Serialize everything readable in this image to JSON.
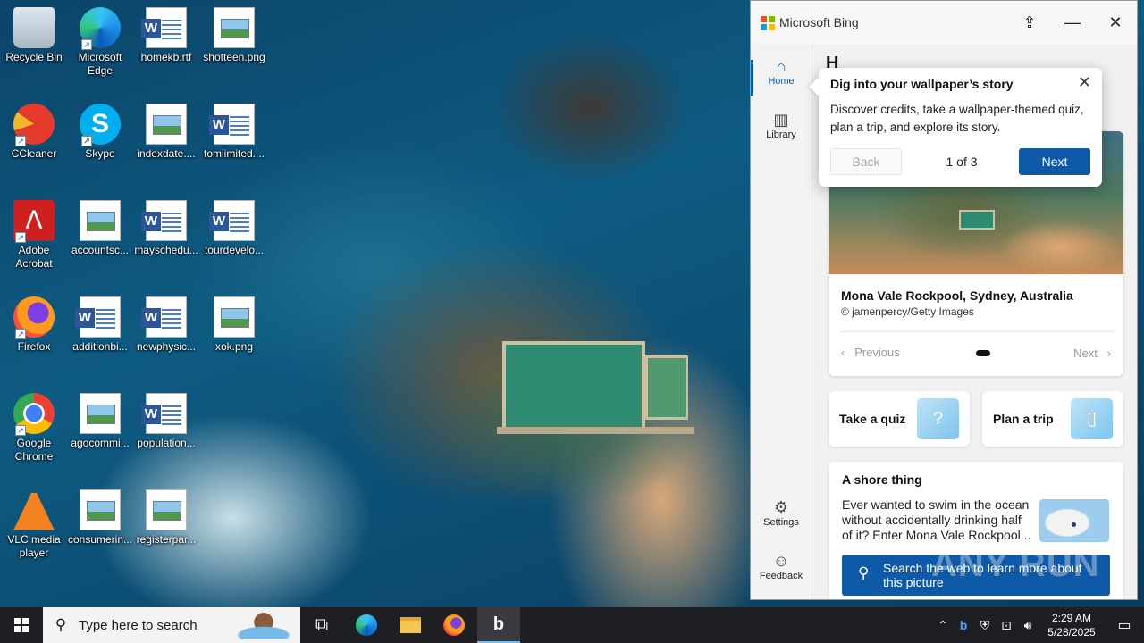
{
  "desktop": {
    "icons": [
      {
        "label": "Recycle Bin",
        "icon": "recycle-bin-icon"
      },
      {
        "label": "Microsoft Edge",
        "icon": "edge-icon"
      },
      {
        "label": "homekb.rtf",
        "icon": "word-doc-icon"
      },
      {
        "label": "shotteen.png",
        "icon": "image-file-icon"
      },
      {
        "label": "CCleaner",
        "icon": "ccleaner-icon"
      },
      {
        "label": "Skype",
        "icon": "skype-icon"
      },
      {
        "label": "indexdate....",
        "icon": "image-file-icon"
      },
      {
        "label": "tomlimited....",
        "icon": "word-doc-icon"
      },
      {
        "label": "Adobe Acrobat",
        "icon": "acrobat-icon"
      },
      {
        "label": "accountsc...",
        "icon": "image-file-icon"
      },
      {
        "label": "mayschedu...",
        "icon": "word-doc-icon"
      },
      {
        "label": "tourdevelo...",
        "icon": "word-doc-icon"
      },
      {
        "label": "Firefox",
        "icon": "firefox-icon"
      },
      {
        "label": "additionbi...",
        "icon": "word-doc-icon"
      },
      {
        "label": "newphysic...",
        "icon": "word-doc-icon"
      },
      {
        "label": "xok.png",
        "icon": "image-file-icon"
      },
      {
        "label": "Google Chrome",
        "icon": "chrome-icon"
      },
      {
        "label": "agocommi...",
        "icon": "image-file-icon"
      },
      {
        "label": "population...",
        "icon": "word-doc-icon"
      },
      {
        "label": "VLC media player",
        "icon": "vlc-icon"
      },
      {
        "label": "consumerin...",
        "icon": "image-file-icon"
      },
      {
        "label": "registerpar...",
        "icon": "image-file-icon"
      }
    ]
  },
  "bing": {
    "title": "Microsoft Bing",
    "logo_colors": [
      "#f25022",
      "#7fba00",
      "#00a4ef",
      "#ffb900"
    ],
    "accent": "#0f5aa8",
    "nav": {
      "home": "Home",
      "library": "Library",
      "settings": "Settings",
      "feedback": "Feedback"
    },
    "home_heading": "H",
    "tip": {
      "title": "Dig into your wallpaper’s story",
      "body": "Discover credits, take a wallpaper-themed quiz, plan a trip, and explore its story.",
      "back": "Back",
      "counter": "1 of 3",
      "next": "Next"
    },
    "wallpaper_card": {
      "title": "Mona Vale Rockpool, Sydney, Australia",
      "credit": "© jamenpercy/Getty Images",
      "previous": "Previous",
      "next": "Next"
    },
    "tiles": {
      "quiz": "Take a quiz",
      "trip": "Plan a trip"
    },
    "story": {
      "title": "A shore thing",
      "body": "Ever wanted to swim in the ocean without accidentally drinking half of it? Enter Mona Vale Rockpool...",
      "search_label": "Search the web to learn more about this picture"
    }
  },
  "taskbar": {
    "search_placeholder": "Type here to search",
    "time": "2:29 AM",
    "date": "5/28/2025"
  },
  "watermark": "ANY RUN"
}
